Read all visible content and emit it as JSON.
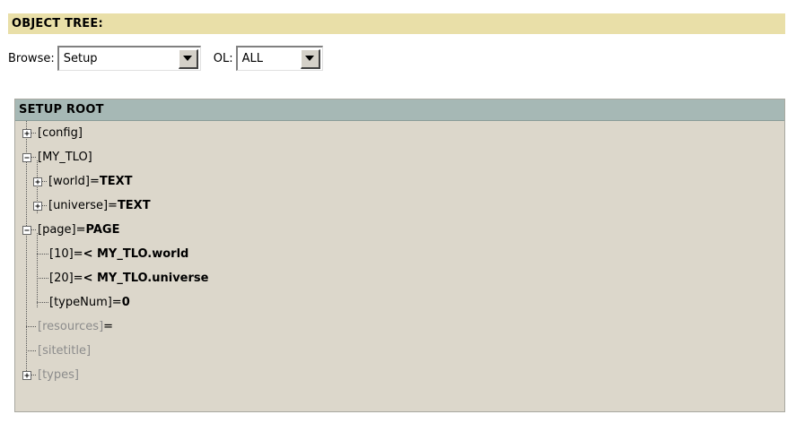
{
  "header": {
    "title": "OBJECT TREE:"
  },
  "browse": {
    "label": "Browse:",
    "selected": "Setup",
    "ol_label": "OL:",
    "ol_selected": "ALL"
  },
  "tree": {
    "title": "SETUP ROOT",
    "nodes": [
      {
        "name": "[config]",
        "value": ""
      },
      {
        "name": "[MY_TLO]",
        "value": ""
      },
      {
        "name": "[world]=",
        "value": "TEXT"
      },
      {
        "name": "[universe]=",
        "value": "TEXT"
      },
      {
        "name": "[page]=",
        "value": "PAGE"
      },
      {
        "name": "[10]=",
        "value": "< MY_TLO.world"
      },
      {
        "name": "[20]=",
        "value": "< MY_TLO.universe"
      },
      {
        "name": "[typeNum]=",
        "value": "0"
      },
      {
        "name": "[resources]",
        "value": "="
      },
      {
        "name": "[sitetitle]",
        "value": ""
      },
      {
        "name": "[types]",
        "value": ""
      }
    ]
  }
}
